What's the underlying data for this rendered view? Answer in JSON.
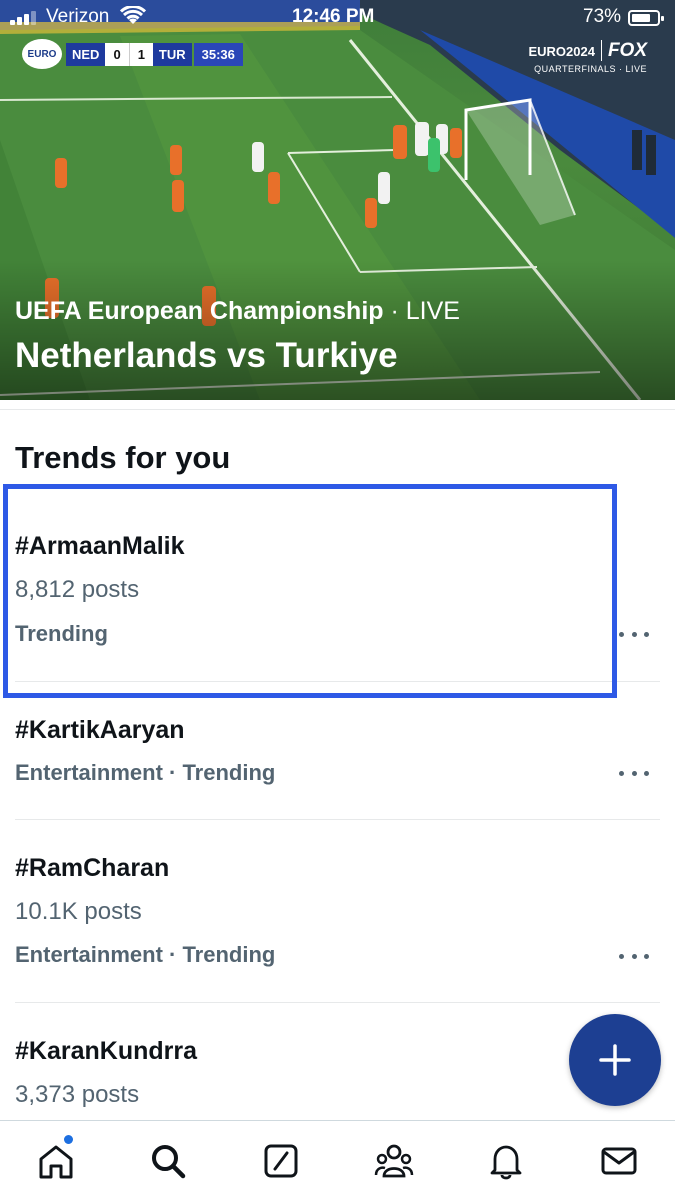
{
  "status_bar": {
    "carrier": "Verizon",
    "time": "12:46 PM",
    "battery": "73%",
    "battery_level": 0.73
  },
  "hero": {
    "scorebug": {
      "logo": "EURO",
      "home_team": "NED",
      "home_score": "0",
      "away_score": "1",
      "away_team": "TUR",
      "clock": "35:36"
    },
    "broadcaster": {
      "brand": "EURO2024",
      "network": "FOX",
      "stage": "QUARTERFINALS · LIVE"
    },
    "subtitle": "UEFA European Championship",
    "live_label": " · LIVE",
    "title": "Netherlands vs Turkiye"
  },
  "trends": {
    "section_title": "Trends for you",
    "items": [
      {
        "name": "#ArmaanMalik",
        "posts": "8,812 posts",
        "category": "Trending"
      },
      {
        "name": "#KartikAaryan",
        "category": "Entertainment · Trending"
      },
      {
        "name": "#RamCharan",
        "posts": "10.1K posts",
        "category": "Entertainment · Trending"
      },
      {
        "name": "#KaranKundrra",
        "posts": "3,373 posts"
      }
    ]
  },
  "fab": {
    "icon": "plus-icon"
  },
  "nav": {
    "items": [
      "home-icon",
      "search-icon",
      "grok-icon",
      "communities-icon",
      "notifications-icon",
      "messages-icon"
    ]
  },
  "colors": {
    "highlight": "#2e59e6",
    "fab": "#1d3f92",
    "secondary_text": "#536471",
    "notification_dot": "#1d6fe0"
  }
}
